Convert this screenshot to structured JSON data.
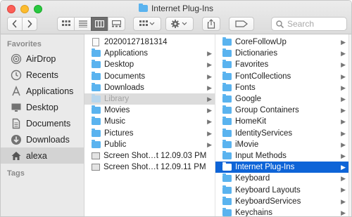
{
  "window": {
    "title": "Internet Plug-Ins"
  },
  "toolbar": {
    "search_placeholder": "Search"
  },
  "sidebar": {
    "favorites_header": "Favorites",
    "items": [
      {
        "label": "AirDrop",
        "icon": "airdrop-icon"
      },
      {
        "label": "Recents",
        "icon": "clock-icon"
      },
      {
        "label": "Applications",
        "icon": "applications-icon"
      },
      {
        "label": "Desktop",
        "icon": "desktop-icon"
      },
      {
        "label": "Documents",
        "icon": "document-icon"
      },
      {
        "label": "Downloads",
        "icon": "download-icon"
      },
      {
        "label": "alexa",
        "icon": "home-icon",
        "selected": true
      }
    ],
    "tags_header": "Tags"
  },
  "column1": {
    "rows": [
      {
        "label": "20200127181314",
        "kind": "doc"
      },
      {
        "label": "Applications",
        "kind": "folder",
        "arrow": true
      },
      {
        "label": "Desktop",
        "kind": "folder",
        "arrow": true
      },
      {
        "label": "Documents",
        "kind": "folder",
        "arrow": true
      },
      {
        "label": "Downloads",
        "kind": "folder",
        "arrow": true
      },
      {
        "label": "Library",
        "kind": "folder",
        "arrow": true,
        "state": "grey"
      },
      {
        "label": "Movies",
        "kind": "folder",
        "arrow": true
      },
      {
        "label": "Music",
        "kind": "folder",
        "arrow": true
      },
      {
        "label": "Pictures",
        "kind": "folder",
        "arrow": true
      },
      {
        "label": "Public",
        "kind": "folder",
        "arrow": true
      },
      {
        "label": "Screen Shot…t 12.09.03 PM",
        "kind": "shot"
      },
      {
        "label": "Screen Shot…t 12.09.11 PM",
        "kind": "shot"
      }
    ]
  },
  "column2": {
    "rows": [
      {
        "label": "CoreFollowUp"
      },
      {
        "label": "Dictionaries"
      },
      {
        "label": "Favorites"
      },
      {
        "label": "FontCollections"
      },
      {
        "label": "Fonts"
      },
      {
        "label": "Google"
      },
      {
        "label": "Group Containers"
      },
      {
        "label": "HomeKit"
      },
      {
        "label": "IdentityServices"
      },
      {
        "label": "iMovie"
      },
      {
        "label": "Input Methods"
      },
      {
        "label": "Internet Plug-Ins",
        "state": "blue"
      },
      {
        "label": "Keyboard"
      },
      {
        "label": "Keyboard Layouts"
      },
      {
        "label": "KeyboardServices"
      },
      {
        "label": "Keychains"
      }
    ]
  },
  "colors": {
    "folder": "#5ab3ef",
    "selection": "#0e64d7",
    "sidebar_bg": "#eaeaea"
  }
}
